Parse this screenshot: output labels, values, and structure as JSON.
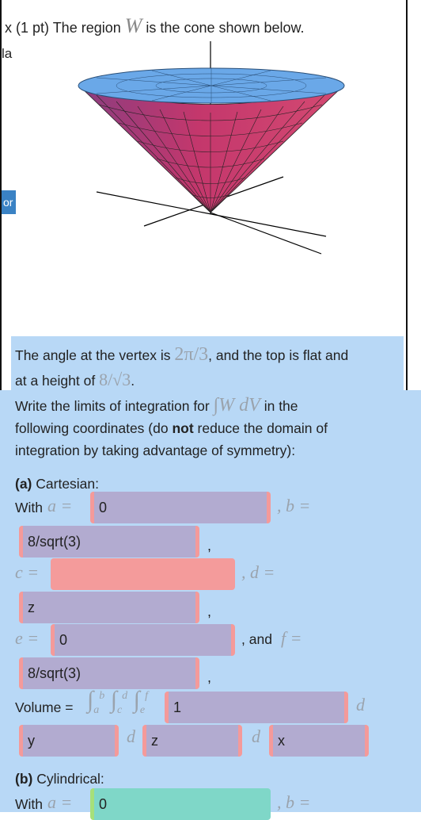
{
  "header": {
    "prefix": "x (1 pt) The region ",
    "region_symbol": "W",
    "suffix": " is the cone shown below.",
    "side_label": "la",
    "side_tab": "or"
  },
  "statement": {
    "angle_text": "The angle at the vertex is ",
    "angle_value": "2π/3",
    "angle_suffix": ", and the top is flat and",
    "height_text": "at a height of ",
    "height_value": "8/√3",
    "height_suffix": ".",
    "limits_text": "Write the limits of integration for ",
    "integral_expr": "∫W dV",
    "limits_suffix": " in the",
    "coords_line": "following coordinates (do ",
    "coords_bold": "not",
    "coords_rest": " reduce the domain of",
    "symmetry_line": "integration by taking advantage of symmetry):"
  },
  "part_a": {
    "heading_bold": "(a)",
    "heading": " Cartesian:",
    "with_label": "With ",
    "a_label": "a =",
    "a_value": "0",
    "b_label": ", b =",
    "b_value": "8/sqrt(3)",
    "c_label": "c =",
    "c_value": "",
    "d_label": ", d =",
    "d_value": "z",
    "e_label": "e =",
    "e_value": "0",
    "and_label": ", and ",
    "f_label": "f =",
    "f_value": "8/sqrt(3)",
    "comma": ",",
    "volume_label": "Volume =",
    "integrand_value": "1",
    "d1_label": "d",
    "d1_value": "y",
    "d2_label": "d",
    "d2_value": "z",
    "d3_label": "d",
    "d3_value": "x"
  },
  "part_b": {
    "heading_bold": "(b)",
    "heading": " Cylindrical:",
    "with_label": "With ",
    "a_label": "a =",
    "a_value": "0",
    "b_label": ", b ="
  },
  "colors": {
    "panel": "#b8d8f6",
    "field_filled": "#b2abd0",
    "field_error": "#f49b9b",
    "field_correct": "#7fd7c8",
    "cone_top": "#6aa8e8",
    "cone_side": "#c23a6a"
  }
}
